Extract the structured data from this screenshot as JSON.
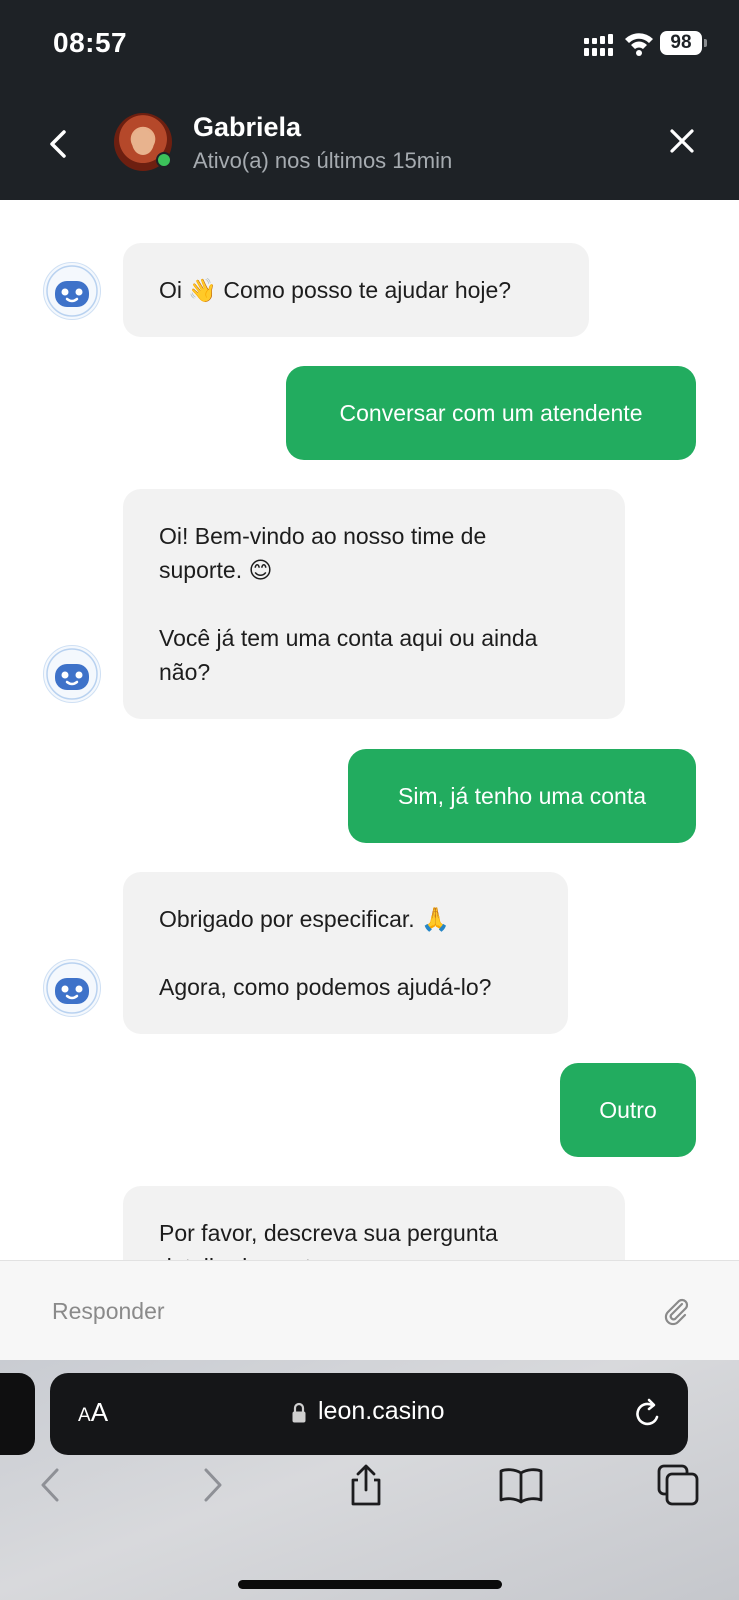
{
  "status_bar": {
    "time": "08:57",
    "battery": "98"
  },
  "header": {
    "contact_name": "Gabriela",
    "contact_status": "Ativo(a) nos últimos 15min"
  },
  "messages": [
    {
      "from": "bot",
      "lines": [
        "Oi 👋 Como posso te ajudar hoje?"
      ]
    },
    {
      "from": "user",
      "text": "Conversar com um atendente"
    },
    {
      "from": "bot",
      "lines": [
        "Oi! Bem-vindo ao nosso time de",
        "suporte. 😊",
        "",
        "Você já tem uma conta aqui ou ainda",
        "não?"
      ]
    },
    {
      "from": "user",
      "text": "Sim, já tenho uma conta"
    },
    {
      "from": "bot",
      "lines": [
        "Obrigado por especificar. 🙏",
        "",
        "Agora, como podemos ajudá-lo?"
      ]
    },
    {
      "from": "user",
      "text": "Outro"
    },
    {
      "from": "bot",
      "lines": [
        "Por favor, descreva sua pergunta",
        "detalhadamente."
      ]
    }
  ],
  "reply": {
    "placeholder": "Responder"
  },
  "browser": {
    "aa_label": "AA",
    "url": "leon.casino"
  },
  "colors": {
    "header_bg": "#1e2226",
    "bubble_out": "#22ac5f",
    "bubble_in": "#f2f2f2",
    "online": "#3cc25a"
  }
}
